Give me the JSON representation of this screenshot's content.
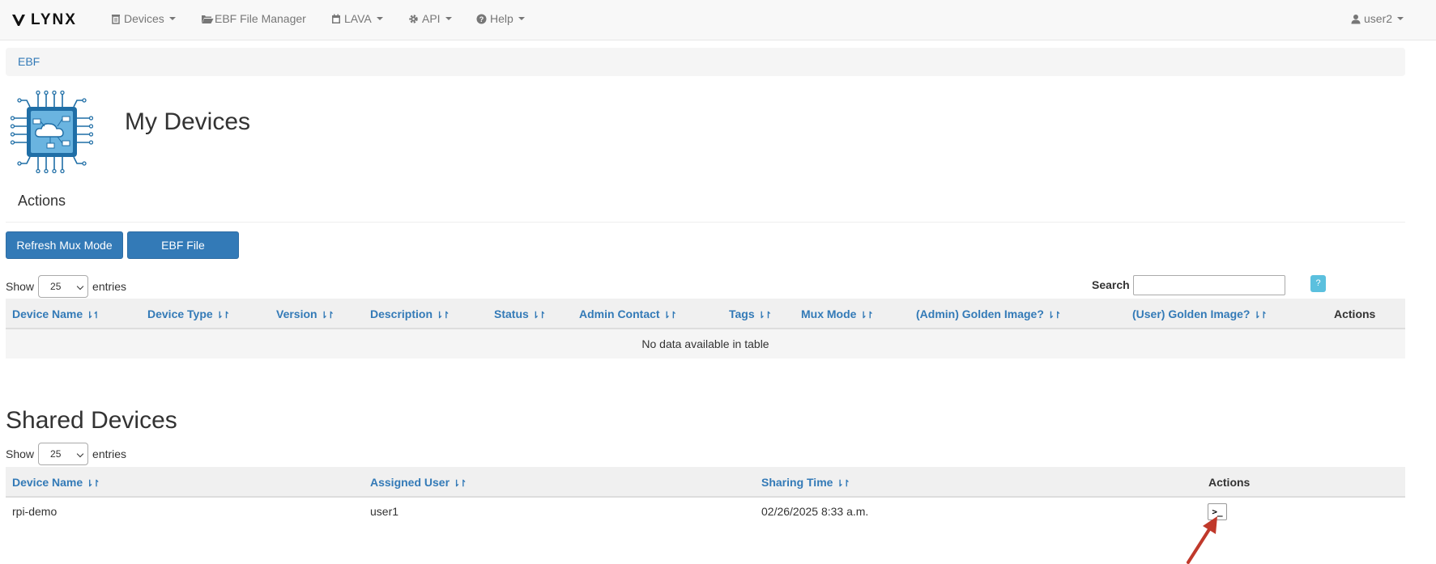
{
  "navbar": {
    "brand": "LYNX",
    "items": [
      {
        "label": "Devices",
        "icon": "trash-icon"
      },
      {
        "label": "EBF File Manager",
        "icon": "folder-open-icon"
      },
      {
        "label": "LAVA",
        "icon": "calendar-icon"
      },
      {
        "label": "API",
        "icon": "gear-icon"
      },
      {
        "label": "Help",
        "icon": "question-circle-icon"
      }
    ],
    "user": "user2"
  },
  "breadcrumb": {
    "item": "EBF"
  },
  "page": {
    "title": "My Devices"
  },
  "actions": {
    "heading": "Actions",
    "refresh_label": "Refresh Mux Mode",
    "ebf_label": "EBF File Manager"
  },
  "my_devices_table": {
    "show_label": "Show",
    "entries_label": "entries",
    "page_length": "25",
    "search_label": "Search",
    "search_value": "",
    "help_label": "?",
    "columns": [
      "Device Name",
      "Device Type",
      "Version",
      "Description",
      "Status",
      "Admin Contact",
      "Tags",
      "Mux Mode",
      "(Admin) Golden Image?",
      "(User) Golden Image?",
      "Actions"
    ],
    "empty_text": "No data available in table"
  },
  "shared_devices": {
    "title": "Shared Devices",
    "show_label": "Show",
    "entries_label": "entries",
    "page_length": "25",
    "columns": [
      "Device Name",
      "Assigned User",
      "Sharing Time",
      "Actions"
    ],
    "rows": [
      {
        "device_name": "rpi-demo",
        "assigned_user": "user1",
        "sharing_time": "02/26/2025 8:33 a.m.",
        "action_label": ">_"
      }
    ]
  },
  "colors": {
    "primary": "#337ab7",
    "info": "#5bc0de",
    "annotation_arrow": "#c0392b"
  }
}
